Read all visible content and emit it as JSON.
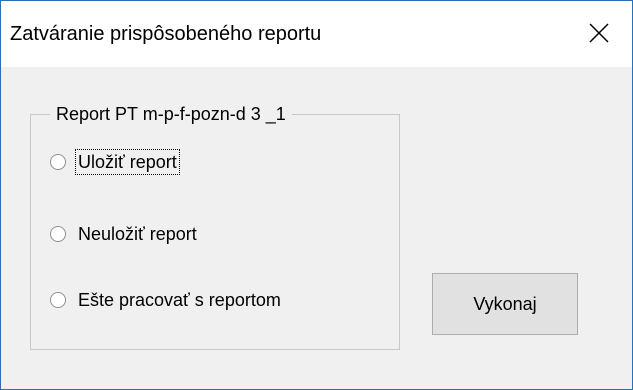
{
  "dialog": {
    "title": "Zatváranie prispôsobeného reportu",
    "close_icon": "close-icon"
  },
  "group": {
    "legend": "Report PT m-p-f-pozn-d 3 _1",
    "options": [
      {
        "label": "Uložiť report",
        "selected": false,
        "focused": true
      },
      {
        "label": "Neuložiť report",
        "selected": false,
        "focused": false
      },
      {
        "label": "Ešte pracovať s reportom",
        "selected": false,
        "focused": false
      }
    ]
  },
  "actions": {
    "execute_label": "Vykonaj"
  },
  "colors": {
    "window_border": "#2b6fb6",
    "dialog_background": "#f0f0f0",
    "button_background": "#e1e1e1"
  }
}
